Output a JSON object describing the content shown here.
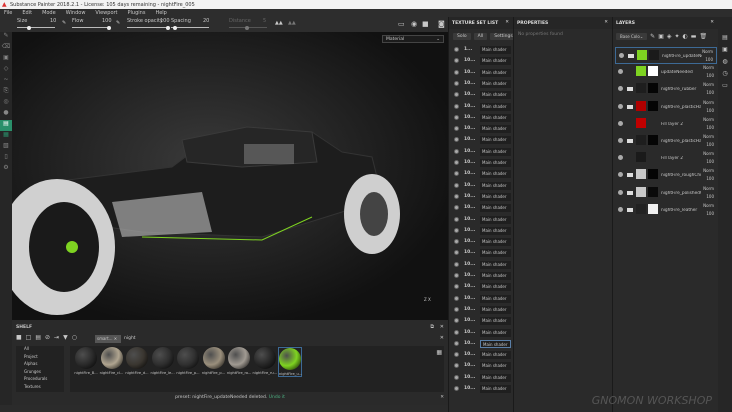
{
  "window": {
    "title": "Substance Painter 2018.2.1 - License: 105 days remaining - nightFire_005"
  },
  "menu": [
    "File",
    "Edit",
    "Mode",
    "Window",
    "Viewport",
    "Plugins",
    "Help"
  ],
  "toolbar": {
    "size_label": "Size",
    "size_value": "10",
    "flow_label": "Flow",
    "flow_value": "100",
    "stroke_label": "Stroke opacity",
    "stroke_value": "100",
    "spacing_label": "Spacing",
    "spacing_value": "20",
    "distance_label": "Distance",
    "distance_value": "5"
  },
  "viewport": {
    "material_mode": "Material",
    "axis": "Z X"
  },
  "shelf": {
    "title": "SHELF",
    "search_tag": "smart...",
    "search_text": "night",
    "categories": [
      "All",
      "Project",
      "Alphas",
      "Grunges",
      "Procedurals",
      "Textures"
    ],
    "materials": [
      {
        "name": "nightFire_B...",
        "color": "#2a2a2a"
      },
      {
        "name": "nightFire_cl...",
        "color": "#b0a590"
      },
      {
        "name": "nightFire_d...",
        "color": "#3a3630"
      },
      {
        "name": "nightFire_le...",
        "color": "#2e2e2e"
      },
      {
        "name": "nightFire_p...",
        "color": "#303030"
      },
      {
        "name": "nightFire_p...",
        "color": "#9a8f7c"
      },
      {
        "name": "nightFire_ro...",
        "color": "#a09a92"
      },
      {
        "name": "nightFire_ru...",
        "color": "#262626"
      },
      {
        "name": "nightFire_u...",
        "color": "#7ed321"
      }
    ],
    "status": "preset: nightFire_updateNeeded deleted.",
    "undo": "Undo it"
  },
  "texture_set_list": {
    "title": "TEXTURE SET LIST",
    "solo": "Solo",
    "all": "All",
    "settings": "Settings",
    "shader": "Main shader",
    "first_name": "1...",
    "row_name": "10...",
    "row_count": 31,
    "selected_index": 26
  },
  "properties": {
    "title": "PROPERTIES",
    "empty": "No properties found"
  },
  "layers": {
    "title": "LAYERS",
    "channel": "Base Colo",
    "items": [
      {
        "name": "nightFire_updateNeeded_1",
        "blend": "Norm",
        "opacity": "100",
        "folder": true,
        "c1": "#7ed321",
        "c2": "#1a1a1a",
        "selected": true
      },
      {
        "name": "updateNeeded",
        "blend": "Norm",
        "opacity": "100",
        "folder": false,
        "c1": "#7ed321",
        "c2": "#ffffff"
      },
      {
        "name": "nightFire_rubber",
        "blend": "Norm",
        "opacity": "100",
        "folder": true,
        "c1": "#1e1e1e",
        "c2": "#050505"
      },
      {
        "name": "nightFire_plasticHar...",
        "blend": "Norm",
        "opacity": "100",
        "folder": true,
        "c1": "#b00000",
        "c2": "#050505"
      },
      {
        "name": "Fill layer 2",
        "blend": "Norm",
        "opacity": "100",
        "folder": false,
        "c1": "#c00000",
        "c2": ""
      },
      {
        "name": "nightFire_plasticHard",
        "blend": "Norm",
        "opacity": "100",
        "folder": true,
        "c1": "#1e1e1e",
        "c2": "#050505"
      },
      {
        "name": "Fill layer 2",
        "blend": "Norm",
        "opacity": "100",
        "folder": false,
        "c1": "#1a1a1a",
        "c2": ""
      },
      {
        "name": "nightFire_roughChr...",
        "blend": "Norm",
        "opacity": "100",
        "folder": true,
        "c1": "#c8c8c8",
        "c2": "#050505"
      },
      {
        "name": "nightFire_polishedC...",
        "blend": "Norm",
        "opacity": "100",
        "folder": true,
        "c1": "#c8c8c8",
        "c2": "#0a0a0a"
      },
      {
        "name": "nightFire_leather",
        "blend": "Norm",
        "opacity": "100",
        "folder": true,
        "c1": "#222222",
        "c2": "#f0f0f0"
      }
    ]
  },
  "watermark": "GNOMON WORKSHOP"
}
